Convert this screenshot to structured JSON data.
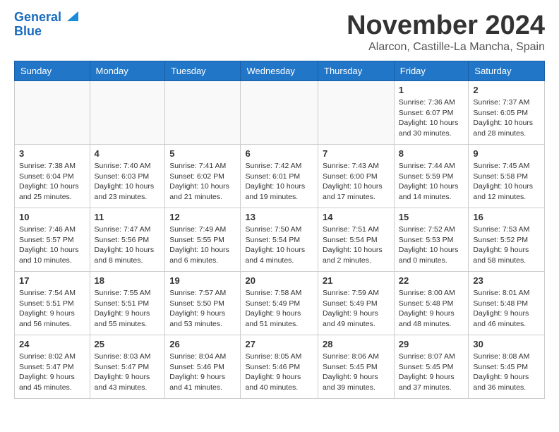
{
  "header": {
    "logo_line1": "General",
    "logo_line2": "Blue",
    "month": "November 2024",
    "location": "Alarcon, Castille-La Mancha, Spain"
  },
  "columns": [
    "Sunday",
    "Monday",
    "Tuesday",
    "Wednesday",
    "Thursday",
    "Friday",
    "Saturday"
  ],
  "weeks": [
    [
      {
        "day": "",
        "info": ""
      },
      {
        "day": "",
        "info": ""
      },
      {
        "day": "",
        "info": ""
      },
      {
        "day": "",
        "info": ""
      },
      {
        "day": "",
        "info": ""
      },
      {
        "day": "1",
        "info": "Sunrise: 7:36 AM\nSunset: 6:07 PM\nDaylight: 10 hours and 30 minutes."
      },
      {
        "day": "2",
        "info": "Sunrise: 7:37 AM\nSunset: 6:05 PM\nDaylight: 10 hours and 28 minutes."
      }
    ],
    [
      {
        "day": "3",
        "info": "Sunrise: 7:38 AM\nSunset: 6:04 PM\nDaylight: 10 hours and 25 minutes."
      },
      {
        "day": "4",
        "info": "Sunrise: 7:40 AM\nSunset: 6:03 PM\nDaylight: 10 hours and 23 minutes."
      },
      {
        "day": "5",
        "info": "Sunrise: 7:41 AM\nSunset: 6:02 PM\nDaylight: 10 hours and 21 minutes."
      },
      {
        "day": "6",
        "info": "Sunrise: 7:42 AM\nSunset: 6:01 PM\nDaylight: 10 hours and 19 minutes."
      },
      {
        "day": "7",
        "info": "Sunrise: 7:43 AM\nSunset: 6:00 PM\nDaylight: 10 hours and 17 minutes."
      },
      {
        "day": "8",
        "info": "Sunrise: 7:44 AM\nSunset: 5:59 PM\nDaylight: 10 hours and 14 minutes."
      },
      {
        "day": "9",
        "info": "Sunrise: 7:45 AM\nSunset: 5:58 PM\nDaylight: 10 hours and 12 minutes."
      }
    ],
    [
      {
        "day": "10",
        "info": "Sunrise: 7:46 AM\nSunset: 5:57 PM\nDaylight: 10 hours and 10 minutes."
      },
      {
        "day": "11",
        "info": "Sunrise: 7:47 AM\nSunset: 5:56 PM\nDaylight: 10 hours and 8 minutes."
      },
      {
        "day": "12",
        "info": "Sunrise: 7:49 AM\nSunset: 5:55 PM\nDaylight: 10 hours and 6 minutes."
      },
      {
        "day": "13",
        "info": "Sunrise: 7:50 AM\nSunset: 5:54 PM\nDaylight: 10 hours and 4 minutes."
      },
      {
        "day": "14",
        "info": "Sunrise: 7:51 AM\nSunset: 5:54 PM\nDaylight: 10 hours and 2 minutes."
      },
      {
        "day": "15",
        "info": "Sunrise: 7:52 AM\nSunset: 5:53 PM\nDaylight: 10 hours and 0 minutes."
      },
      {
        "day": "16",
        "info": "Sunrise: 7:53 AM\nSunset: 5:52 PM\nDaylight: 9 hours and 58 minutes."
      }
    ],
    [
      {
        "day": "17",
        "info": "Sunrise: 7:54 AM\nSunset: 5:51 PM\nDaylight: 9 hours and 56 minutes."
      },
      {
        "day": "18",
        "info": "Sunrise: 7:55 AM\nSunset: 5:51 PM\nDaylight: 9 hours and 55 minutes."
      },
      {
        "day": "19",
        "info": "Sunrise: 7:57 AM\nSunset: 5:50 PM\nDaylight: 9 hours and 53 minutes."
      },
      {
        "day": "20",
        "info": "Sunrise: 7:58 AM\nSunset: 5:49 PM\nDaylight: 9 hours and 51 minutes."
      },
      {
        "day": "21",
        "info": "Sunrise: 7:59 AM\nSunset: 5:49 PM\nDaylight: 9 hours and 49 minutes."
      },
      {
        "day": "22",
        "info": "Sunrise: 8:00 AM\nSunset: 5:48 PM\nDaylight: 9 hours and 48 minutes."
      },
      {
        "day": "23",
        "info": "Sunrise: 8:01 AM\nSunset: 5:48 PM\nDaylight: 9 hours and 46 minutes."
      }
    ],
    [
      {
        "day": "24",
        "info": "Sunrise: 8:02 AM\nSunset: 5:47 PM\nDaylight: 9 hours and 45 minutes."
      },
      {
        "day": "25",
        "info": "Sunrise: 8:03 AM\nSunset: 5:47 PM\nDaylight: 9 hours and 43 minutes."
      },
      {
        "day": "26",
        "info": "Sunrise: 8:04 AM\nSunset: 5:46 PM\nDaylight: 9 hours and 41 minutes."
      },
      {
        "day": "27",
        "info": "Sunrise: 8:05 AM\nSunset: 5:46 PM\nDaylight: 9 hours and 40 minutes."
      },
      {
        "day": "28",
        "info": "Sunrise: 8:06 AM\nSunset: 5:45 PM\nDaylight: 9 hours and 39 minutes."
      },
      {
        "day": "29",
        "info": "Sunrise: 8:07 AM\nSunset: 5:45 PM\nDaylight: 9 hours and 37 minutes."
      },
      {
        "day": "30",
        "info": "Sunrise: 8:08 AM\nSunset: 5:45 PM\nDaylight: 9 hours and 36 minutes."
      }
    ]
  ]
}
